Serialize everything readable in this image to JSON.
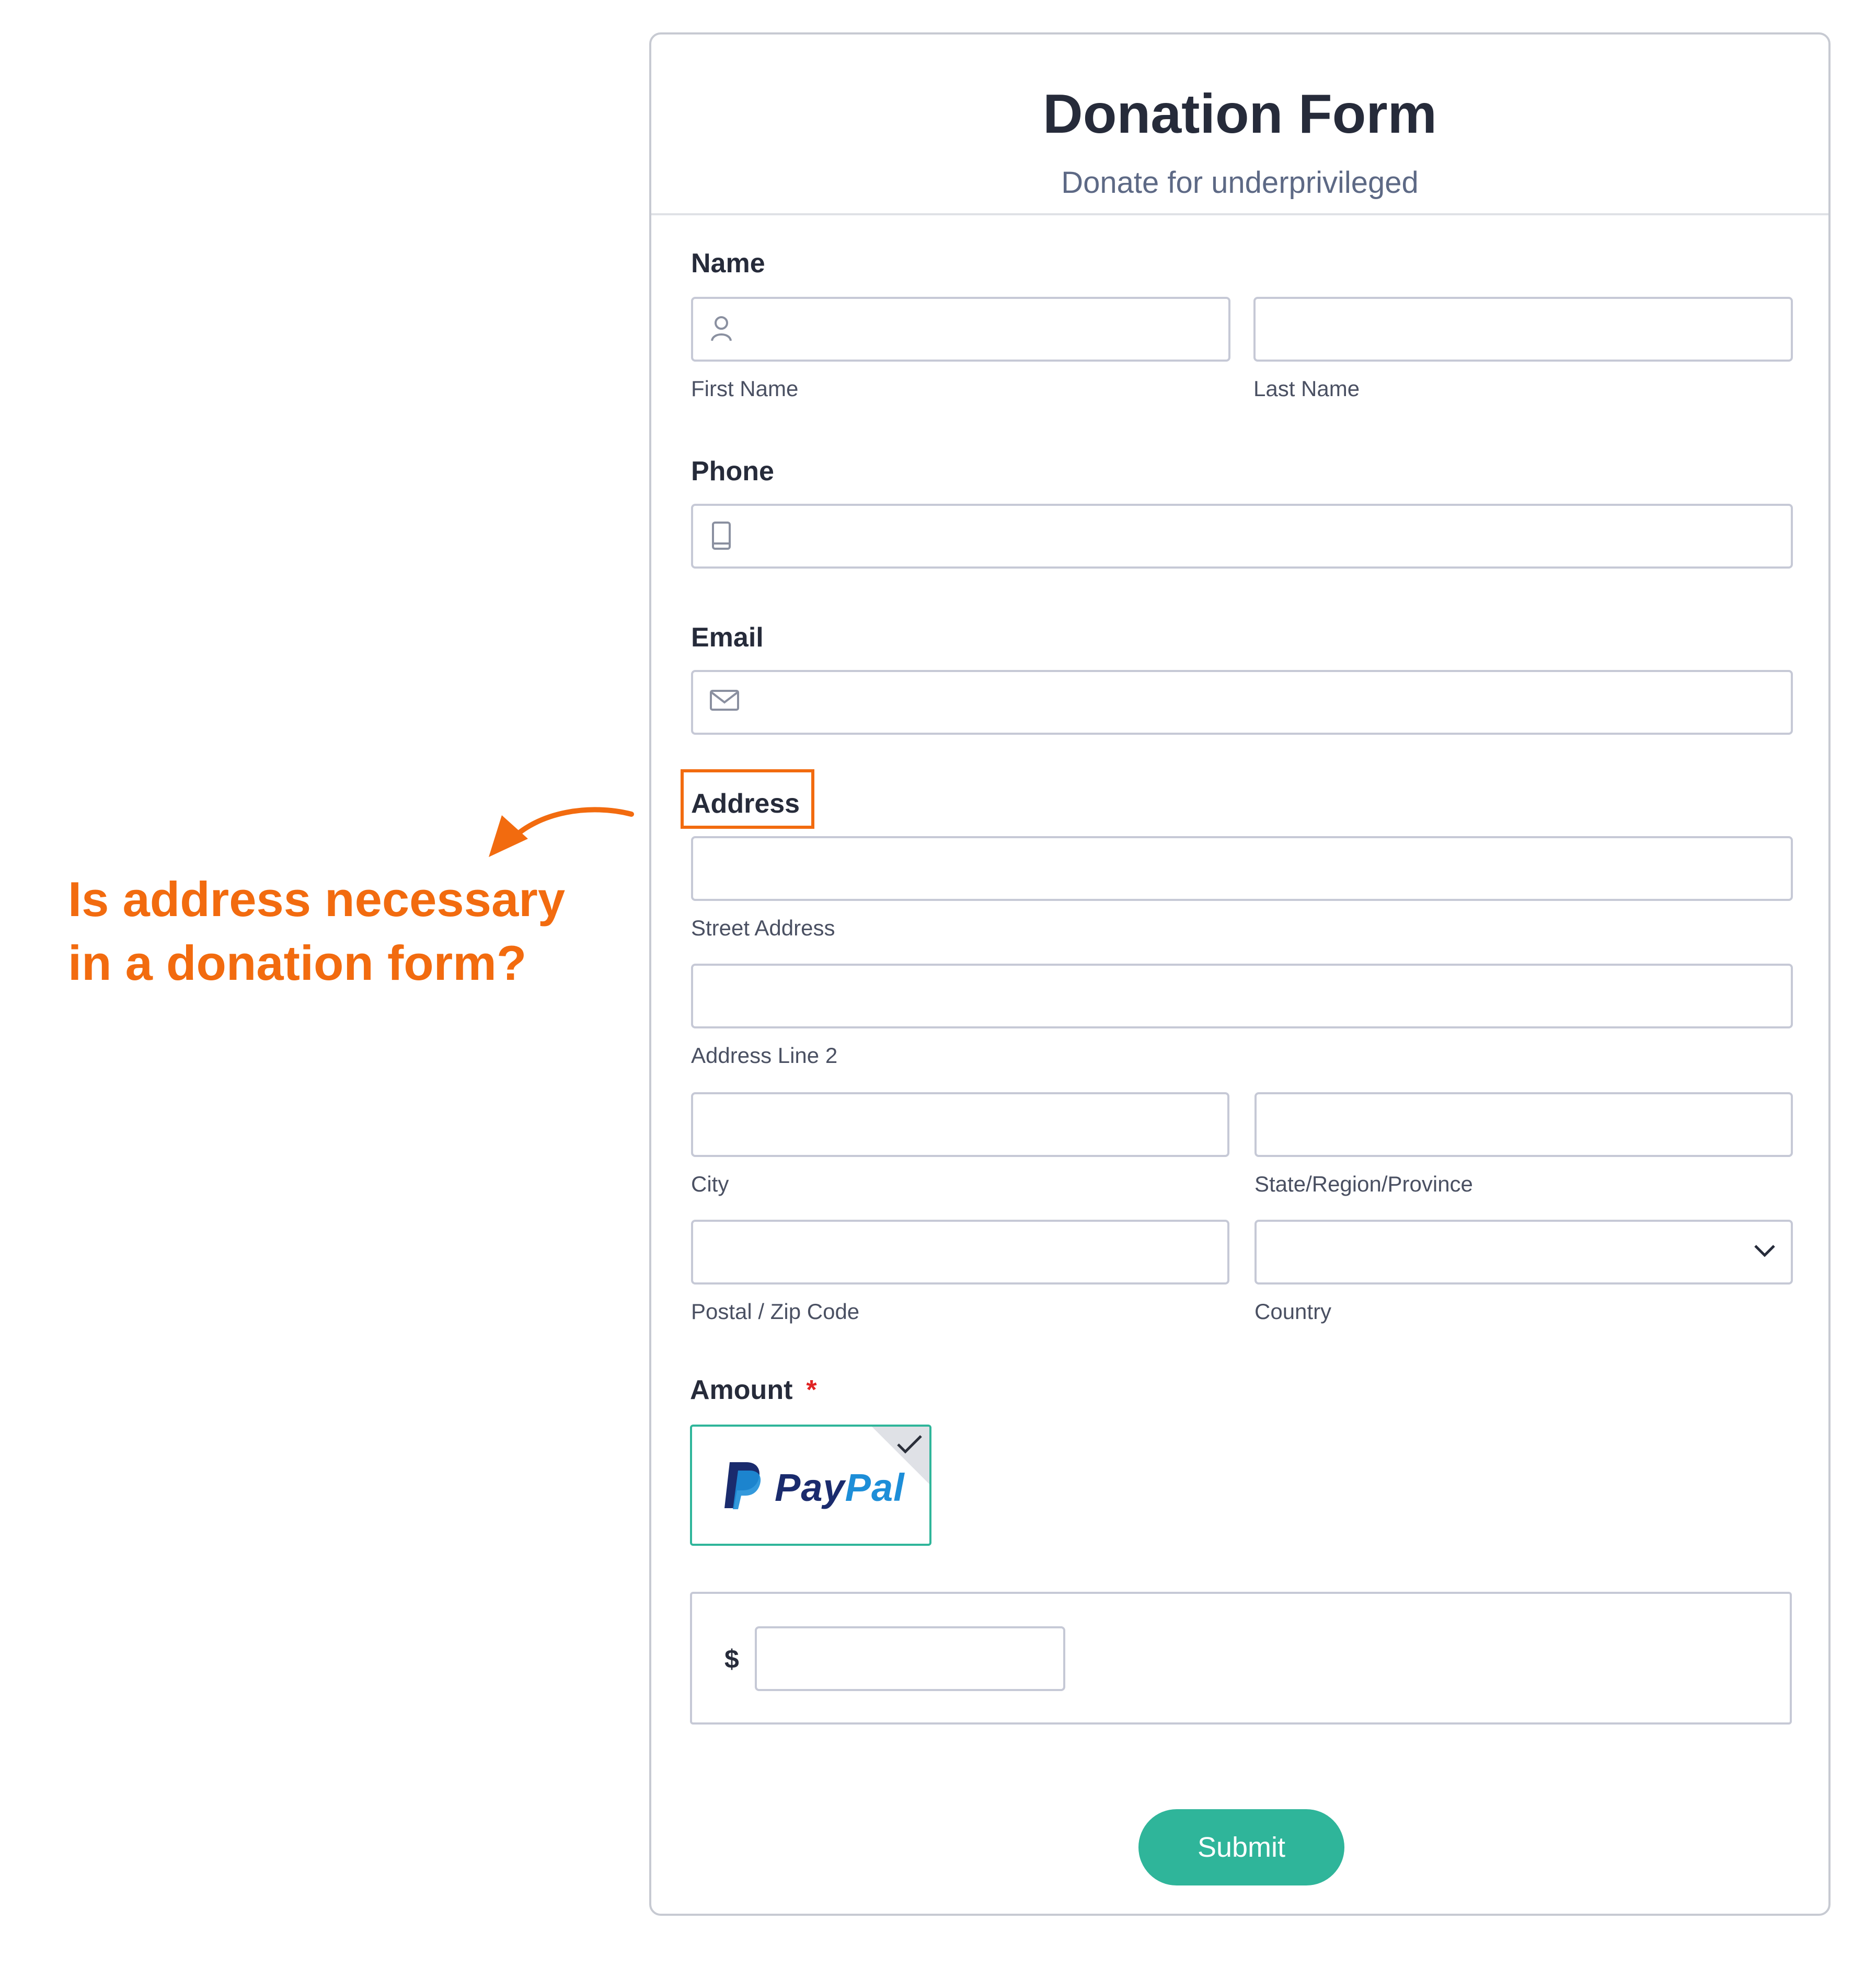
{
  "annotation": {
    "line1": "Is address necessary",
    "line2": "in a donation form?",
    "color": "#f26b0f"
  },
  "form": {
    "title": "Donation Form",
    "subtitle": "Donate for underprivileged"
  },
  "name": {
    "label": "Name",
    "first_label": "First Name",
    "last_label": "Last Name",
    "first_value": "",
    "last_value": "",
    "icon": "user-icon"
  },
  "phone": {
    "label": "Phone",
    "value": "",
    "icon": "phone-icon"
  },
  "email": {
    "label": "Email",
    "value": "",
    "icon": "mail-icon"
  },
  "address": {
    "label": "Address",
    "street_label": "Street Address",
    "line2_label": "Address Line 2",
    "city_label": "City",
    "state_label": "State/Region/Province",
    "postal_label": "Postal / Zip Code",
    "country_label": "Country",
    "country_value": "",
    "country_icon": "chevron-down-icon"
  },
  "amount": {
    "label": "Amount",
    "required_mark": "*",
    "payment_method_word1": "Pay",
    "payment_method_word2": "Pal",
    "payment_selected": true,
    "currency_symbol": "$",
    "value": ""
  },
  "submit_label": "Submit",
  "colors": {
    "accent": "#2fb59a",
    "annotation": "#f26b0f",
    "required": "#e02424",
    "paypal_dark": "#1a2b6d",
    "paypal_light": "#1d8ed8"
  }
}
